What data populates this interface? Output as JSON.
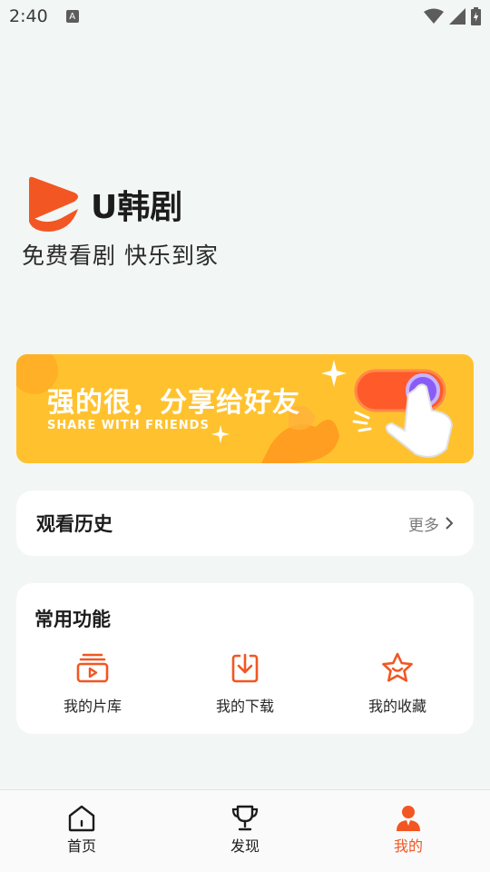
{
  "status_bar": {
    "time": "2:40",
    "notification_letter": "A"
  },
  "brand": {
    "name": "U韩剧",
    "slogan": "免费看剧 快乐到家",
    "accent": "#f25622"
  },
  "banner": {
    "title": "强的很，分享给好友",
    "subtitle": "SHARE WITH FRIENDS",
    "background": "#ffc22e"
  },
  "history": {
    "title": "观看历史",
    "more_label": "更多"
  },
  "features": {
    "title": "常用功能",
    "items": [
      {
        "label": "我的片库",
        "icon": "library-icon"
      },
      {
        "label": "我的下载",
        "icon": "download-icon"
      },
      {
        "label": "我的收藏",
        "icon": "star-icon"
      }
    ]
  },
  "tabbar": {
    "items": [
      {
        "label": "首页",
        "icon": "home-icon",
        "active": false
      },
      {
        "label": "发现",
        "icon": "trophy-icon",
        "active": false
      },
      {
        "label": "我的",
        "icon": "profile-icon",
        "active": true
      }
    ]
  }
}
